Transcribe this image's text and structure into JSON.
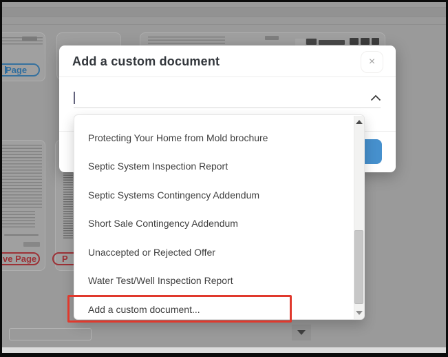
{
  "modal": {
    "title": "Add a custom document",
    "close_label": "×",
    "combobox": {
      "value": "",
      "placeholder": "",
      "state": "expanded"
    }
  },
  "dropdown": {
    "items": [
      "Protecting Your Home from Mold brochure",
      "Septic System Inspection Report",
      "Septic Systems Contingency Addendum",
      "Short Sale Contingency Addendum",
      "Unaccepted or Rejected Offer",
      "Water Test/Well Inspection Report",
      "Add a custom document..."
    ],
    "highlighted_index": 6,
    "highlighted_item": "Add a custom document..."
  },
  "annotation": {
    "type": "highlight-box",
    "target": "Add a custom document..."
  },
  "background": {
    "page_pill_label": "Page",
    "remove_page_pill_label": "ve Page",
    "second_pill_partial_label": "P"
  },
  "colors": {
    "primary_button": "#4690cd",
    "highlight_box": "#e0392d",
    "page_pill_blue": "#2f6d9e",
    "remove_pill_red": "#9c3136",
    "overlay_gray": "#9a9a9a"
  }
}
